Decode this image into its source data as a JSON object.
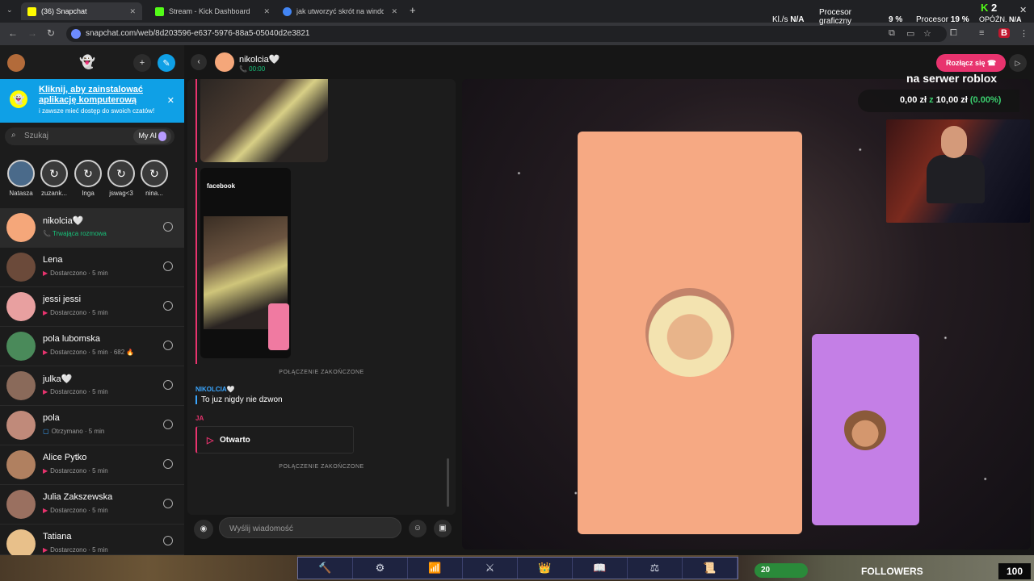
{
  "browser": {
    "tabs": [
      {
        "title": "(36) Snapchat",
        "favicon_color": "#fffc00"
      },
      {
        "title": "Stream - Kick Dashboard",
        "favicon_color": "#53fc18"
      },
      {
        "title": "jak utworzyć skrót na windows",
        "favicon_color": "#4285f4"
      }
    ],
    "new_tab": "+",
    "url": "snapchat.com/web/8d203596-e637-5976-88a5-05040d2e3821",
    "back": "←",
    "forward": "→",
    "reload": "↻"
  },
  "system_stats": {
    "kl_label": "Kl./s",
    "kl_value": "N/A",
    "gpu_label": "Procesor graficzny",
    "gpu_value": "9 %",
    "cpu_label": "Procesor",
    "cpu_value": "19 %",
    "lat_label": "OPÓŹN.",
    "lat_value": "N/A",
    "kick_count": "2"
  },
  "sidebar": {
    "install_title": "Kliknij, aby zainstalować aplikację komputerową",
    "install_sub": "i zawsze mieć dostęp do swoich czatów!",
    "search_placeholder": "Szukaj",
    "my_ai": "My AI",
    "stories": [
      {
        "name": "Natasza"
      },
      {
        "name": "zuzank..."
      },
      {
        "name": "Inga"
      },
      {
        "name": "jswag<3"
      },
      {
        "name": "nina..."
      }
    ],
    "chats": [
      {
        "name": "nikolcia🤍",
        "status": "Trwająca rozmowa",
        "avatar_color": "#f5a77a",
        "active": true
      },
      {
        "name": "Lena",
        "status": "Dostarczono · 5 min",
        "avatar_color": "#6b4a3a"
      },
      {
        "name": "jessi jessi",
        "status": "Dostarczono · 5 min",
        "avatar_color": "#e8a0a0"
      },
      {
        "name": "pola lubomska",
        "status": "Dostarczono · 5 min · 682 🔥",
        "avatar_color": "#4a8a5a"
      },
      {
        "name": "julka🤍",
        "status": "Dostarczono · 5 min",
        "avatar_color": "#8a6a5a"
      },
      {
        "name": "pola",
        "status": "Otrzymano · 5 min",
        "avatar_color": "#c08a7a"
      },
      {
        "name": "Alice Pytko",
        "status": "Dostarczono · 5 min",
        "avatar_color": "#b08060"
      },
      {
        "name": "Julia Zakszewska",
        "status": "Dostarczono · 5 min",
        "avatar_color": "#9a7060"
      },
      {
        "name": "Tatiana",
        "status": "Dostarczono · 5 min",
        "avatar_color": "#e8c08a"
      }
    ]
  },
  "chat": {
    "contact": "nikolcia🤍",
    "call_time": "📞 00:00",
    "phone_app_name": "facebook",
    "system_ended_1": "POŁĄCZENIE ZAKOŃCZONE",
    "from_label": "NIKOLCIA🤍",
    "message": "To juz nigdy nie dzwon",
    "me_label": "JA",
    "opened": "Otwarto",
    "system_ended_2": "POŁĄCZENIE ZAKOŃCZONE",
    "composer_placeholder": "Wyślij wiadomość"
  },
  "call": {
    "disconnect": "Rozłącz się",
    "overlay_title": "na serwer roblox",
    "overlay_current": "0,00 zł",
    "overlay_sep": "z",
    "overlay_goal": "10,00 zł",
    "overlay_pct": "(0.00%)"
  },
  "gamebar": {
    "slots": [
      "🔨",
      "⚙",
      "📶",
      "⚔",
      "👑",
      "📖",
      "⚖",
      "📜"
    ],
    "xp": "20",
    "followers_label": "FOLLOWERS",
    "followers_count": "100"
  }
}
